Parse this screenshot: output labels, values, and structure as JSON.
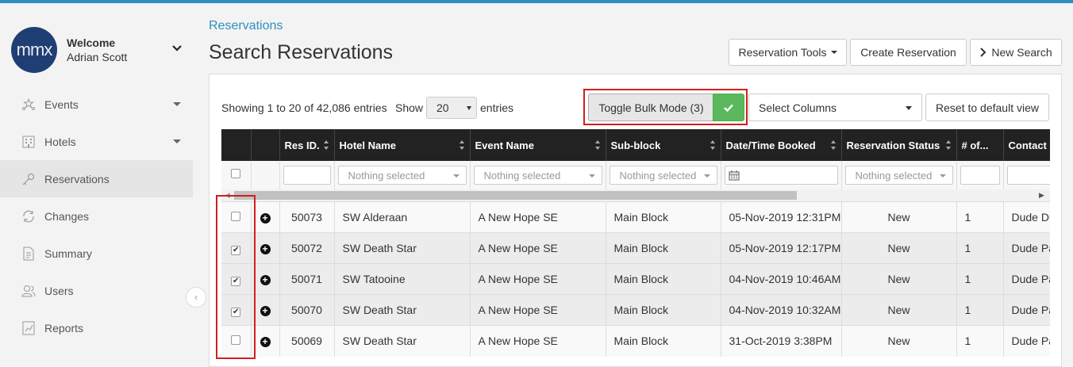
{
  "user": {
    "avatar_text": "mmx",
    "welcome": "Welcome",
    "name": "Adrian Scott"
  },
  "nav": {
    "items": [
      {
        "label": "Events",
        "icon": "stars-icon",
        "has_caret": true
      },
      {
        "label": "Hotels",
        "icon": "building-icon",
        "has_caret": true
      },
      {
        "label": "Reservations",
        "icon": "key-icon",
        "active": true
      },
      {
        "label": "Changes",
        "icon": "refresh-icon"
      },
      {
        "label": "Summary",
        "icon": "document-icon"
      },
      {
        "label": "Users",
        "icon": "users-icon"
      },
      {
        "label": "Reports",
        "icon": "chart-icon"
      }
    ]
  },
  "breadcrumb": "Reservations",
  "page_title": "Search Reservations",
  "toolbar": {
    "reservation_tools": "Reservation Tools",
    "create_reservation": "Create Reservation",
    "new_search": "New Search"
  },
  "table_controls": {
    "info": "Showing 1 to 20 of 42,086 entries",
    "show_label": "Show",
    "show_value": "20",
    "entries_label": "entries",
    "toggle_bulk": "Toggle Bulk Mode (3)",
    "select_columns": "Select Columns",
    "reset_view": "Reset to default view"
  },
  "columns": [
    "Res ID.",
    "Hotel Name",
    "Event Name",
    "Sub-block",
    "Date/Time Booked",
    "Reservation Status",
    "# of...",
    "Contact Na"
  ],
  "filters": {
    "nothing_selected": "Nothing selected"
  },
  "rows": [
    {
      "id": "50073",
      "hotel": "SW Alderaan",
      "event": "A New Hope SE",
      "subblock": "Main Block",
      "booked": "05-Nov-2019 12:31PM",
      "status": "New",
      "count": "1",
      "contact": "Dude Du",
      "checked": false
    },
    {
      "id": "50072",
      "hotel": "SW Death Star",
      "event": "A New Hope SE",
      "subblock": "Main Block",
      "booked": "05-Nov-2019 12:17PM",
      "status": "New",
      "count": "1",
      "contact": "Dude Pa",
      "checked": true
    },
    {
      "id": "50071",
      "hotel": "SW Tatooine",
      "event": "A New Hope SE",
      "subblock": "Main Block",
      "booked": "04-Nov-2019 10:46AM",
      "status": "New",
      "count": "1",
      "contact": "Dude Pa",
      "checked": true
    },
    {
      "id": "50070",
      "hotel": "SW Death Star",
      "event": "A New Hope SE",
      "subblock": "Main Block",
      "booked": "04-Nov-2019 10:32AM",
      "status": "New",
      "count": "1",
      "contact": "Dude Pa",
      "checked": true
    },
    {
      "id": "50069",
      "hotel": "SW Death Star",
      "event": "A New Hope SE",
      "subblock": "Main Block",
      "booked": "31-Oct-2019 3:38PM",
      "status": "New",
      "count": "1",
      "contact": "Dude Pa",
      "checked": false
    }
  ],
  "colors": {
    "accent": "#2f8fc0",
    "highlight": "#d01f1f",
    "success": "#5cb85c",
    "header_bg": "#222222"
  }
}
